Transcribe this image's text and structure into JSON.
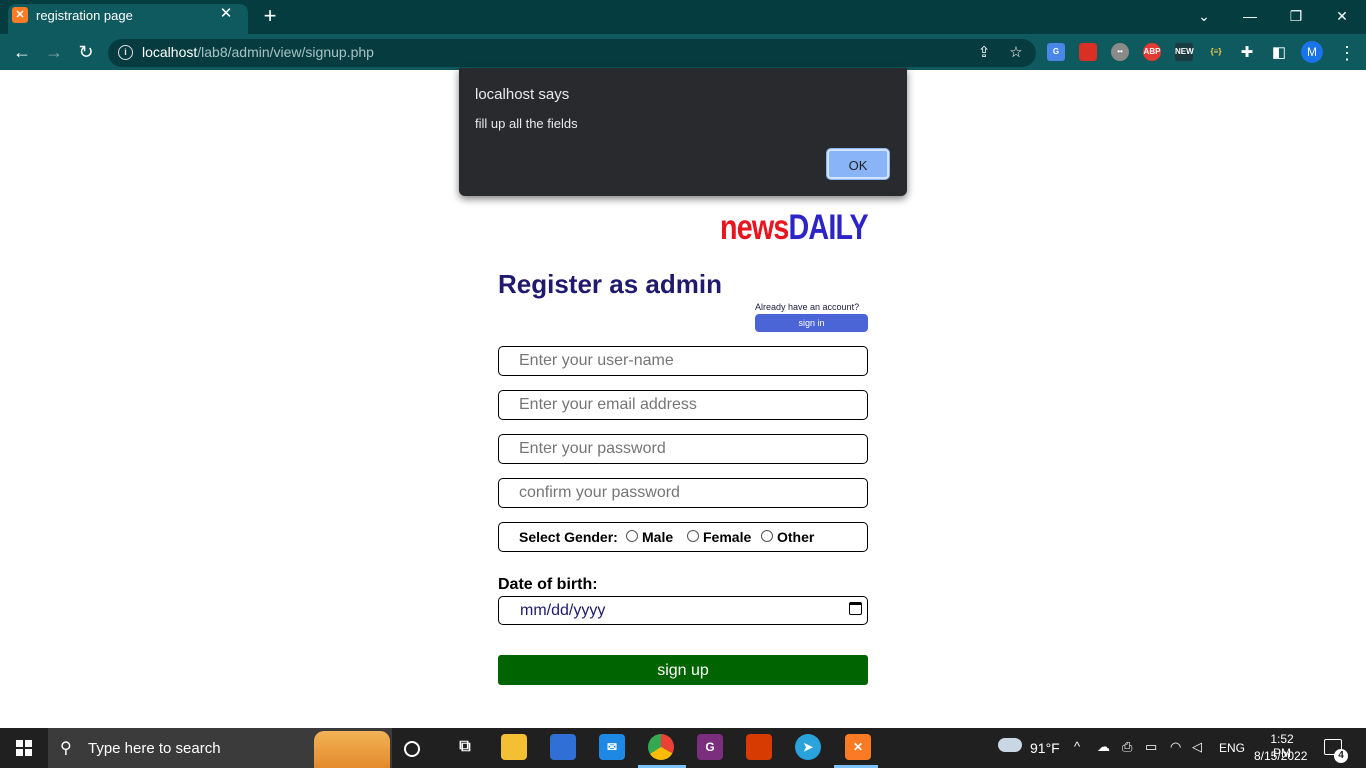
{
  "browser": {
    "tab_title": "registration page",
    "tab_close": "✕",
    "new_tab": "+",
    "url_host": "localhost",
    "url_path": "/lab8/admin/view/signup.php",
    "profile_initial": "M"
  },
  "dialog": {
    "title": "localhost says",
    "message": "fill up all the fields",
    "ok_label": "OK"
  },
  "page": {
    "logo_news": "news",
    "logo_daily": "DAILY",
    "heading": "Register as admin",
    "already_text": "Already have an account?",
    "signin_label": "sign in",
    "fields": {
      "username_placeholder": "Enter your user-name",
      "email_placeholder": "Enter your email address",
      "password_placeholder": "Enter your password",
      "confirm_placeholder": "confirm your password"
    },
    "gender": {
      "label": "Select Gender:",
      "options": [
        "Male",
        "Female",
        "Other"
      ]
    },
    "dob_label": "Date of birth:",
    "dob_placeholder": "mm/dd/yyyy",
    "signup_label": "sign up"
  },
  "taskbar": {
    "search_placeholder": "Type here to search",
    "weather": "91°F",
    "language": "ENG",
    "time": "1:52 PM",
    "date": "8/15/2022",
    "notification_count": "4"
  },
  "colors": {
    "chrome_frame": "#053c40",
    "toolbar": "#0f5a5e",
    "logo_news": "#e8141e",
    "logo_daily": "#2d24c8",
    "heading": "#1f1a6e",
    "signin_button": "#4b65d6",
    "signup_button": "#006400",
    "dialog_bg": "#292a2d",
    "dialog_ok": "#8ab4f8"
  }
}
